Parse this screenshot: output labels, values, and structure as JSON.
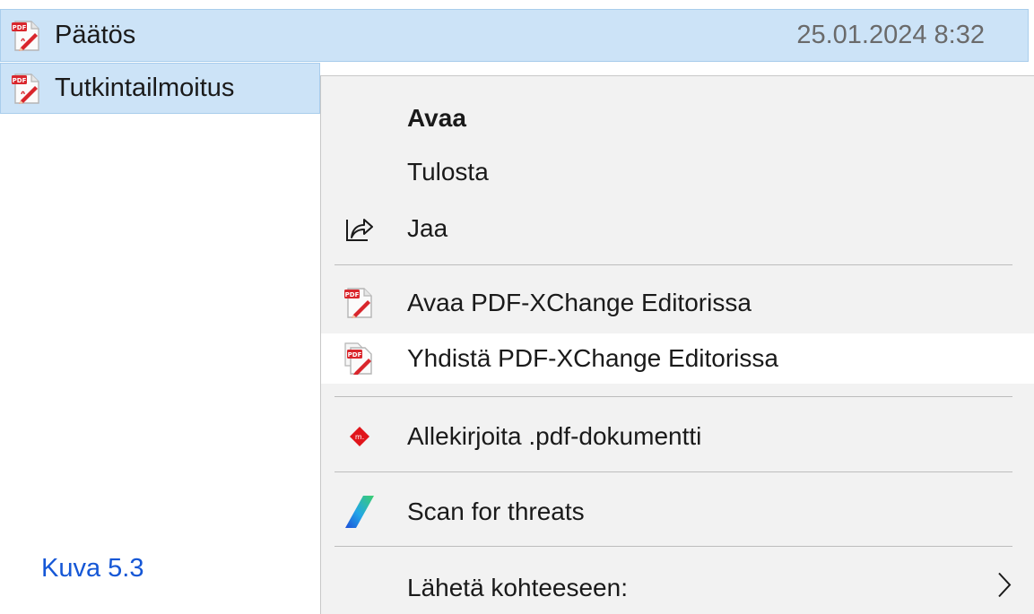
{
  "files": [
    {
      "name": "Päätös",
      "date": "25.01.2024 8:32",
      "icon": "pdf-file-icon"
    },
    {
      "name": "Tutkintailmoitus",
      "icon": "pdf-file-icon"
    }
  ],
  "context_menu": {
    "items": [
      {
        "label": "Avaa",
        "bold": true
      },
      {
        "label": "Tulosta"
      },
      {
        "label": "Jaa",
        "icon": "share-icon"
      },
      {
        "label": "Avaa PDF-XChange Editorissa",
        "icon": "pdf-xchange-icon"
      },
      {
        "label": "Yhdistä PDF-XChange Editorissa",
        "icon": "pdf-xchange-combine-icon",
        "highlighted": true
      },
      {
        "label": "Allekirjoita .pdf-dokumentti",
        "icon": "sign-icon",
        "icon_color": "#e0151b"
      },
      {
        "label": "Scan for threats",
        "icon": "scan-icon"
      },
      {
        "label": "Lähetä kohteeseen:",
        "icon": "chevron-right-icon",
        "has_submenu": true
      }
    ]
  },
  "caption": "Kuva 5.3",
  "colors": {
    "selection": "#cce3f7",
    "selection_border": "#a9cdec",
    "menu_bg": "#f2f2f2",
    "caption": "#1557d6"
  }
}
